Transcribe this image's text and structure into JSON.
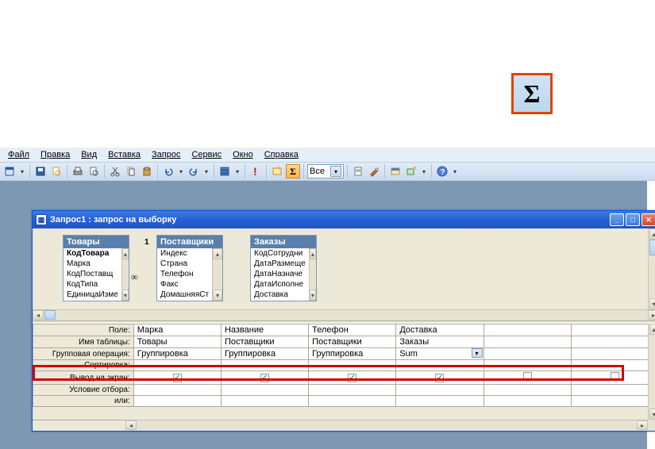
{
  "menubar": {
    "file": "Файл",
    "edit": "Правка",
    "view": "Вид",
    "insert": "Вставка",
    "query": "Запрос",
    "tools": "Сервис",
    "window": "Окно",
    "help": "Справка"
  },
  "toolbar": {
    "sigma": "Σ",
    "combo_value": "Все"
  },
  "sigma_callout": "Σ",
  "window": {
    "title": "Запрос1 : запрос на выборку"
  },
  "tables": {
    "t1": {
      "name": "Товары",
      "fields": [
        "КодТовара",
        "Марка",
        "КодПоставщ",
        "КодТипа",
        "ЕдиницаИзме"
      ]
    },
    "t2": {
      "name": "Поставщики",
      "fields": [
        "Индекс",
        "Страна",
        "Телефон",
        "Факс",
        "ДомашняяСт"
      ]
    },
    "t3": {
      "name": "Заказы",
      "fields": [
        "КодСотрудни",
        "ДатаРазмеще",
        "ДатаНазначе",
        "ДатаИсполне",
        "Доставка"
      ]
    },
    "rel1": "1",
    "relinf": "∞"
  },
  "grid": {
    "rowlabels": {
      "field": "Поле:",
      "table": "Имя таблицы:",
      "groupop": "Групповая операция:",
      "sort": "Сортировка:",
      "show": "Вывод на экран:",
      "criteria": "Условие отбора:",
      "or": "или:"
    },
    "cols": [
      {
        "field": "Марка",
        "table": "Товары",
        "groupop": "Группировка",
        "show": true
      },
      {
        "field": "Название",
        "table": "Поставщики",
        "groupop": "Группировка",
        "show": true
      },
      {
        "field": "Телефон",
        "table": "Поставщики",
        "groupop": "Группировка",
        "show": true
      },
      {
        "field": "Доставка",
        "table": "Заказы",
        "groupop": "Sum",
        "show": true,
        "active": true
      },
      {
        "field": "",
        "table": "",
        "groupop": "",
        "show": false
      },
      {
        "field": "",
        "table": "",
        "groupop": "",
        "show": false
      }
    ]
  }
}
